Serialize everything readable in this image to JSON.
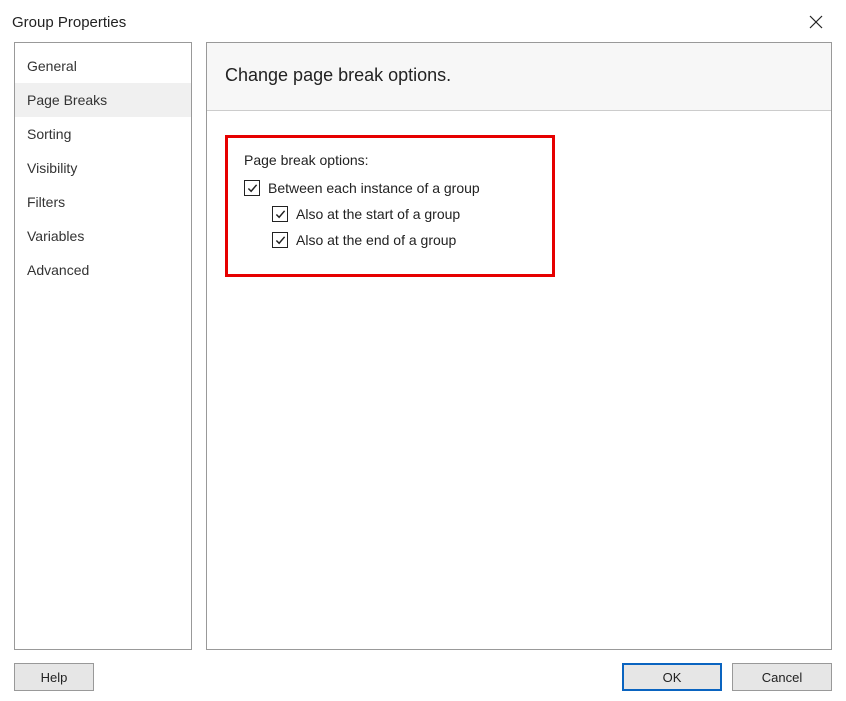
{
  "title": "Group Properties",
  "sidebar": {
    "items": [
      {
        "label": "General",
        "selected": false
      },
      {
        "label": "Page Breaks",
        "selected": true
      },
      {
        "label": "Sorting",
        "selected": false
      },
      {
        "label": "Visibility",
        "selected": false
      },
      {
        "label": "Filters",
        "selected": false
      },
      {
        "label": "Variables",
        "selected": false
      },
      {
        "label": "Advanced",
        "selected": false
      }
    ]
  },
  "main": {
    "header": "Change page break options.",
    "section_label": "Page break options:",
    "options": {
      "between_label": "Between each instance of a group",
      "between_checked": true,
      "start_label": "Also at the start of a group",
      "start_checked": true,
      "end_label": "Also at the end of a group",
      "end_checked": true
    }
  },
  "buttons": {
    "help": "Help",
    "ok": "OK",
    "cancel": "Cancel"
  },
  "colors": {
    "highlight_border": "#e60000",
    "primary_border": "#0a64c0"
  }
}
